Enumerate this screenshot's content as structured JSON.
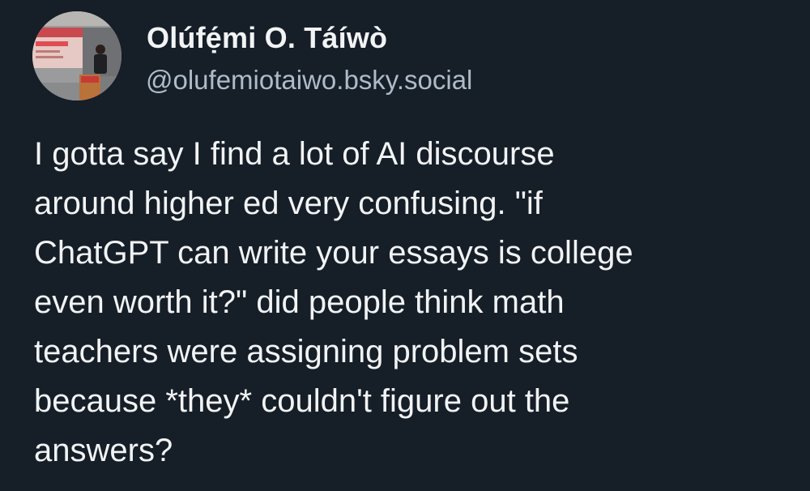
{
  "author": {
    "display_name": "Olúfẹ́mi O. Táíwò",
    "handle": "@olufemiotaiwo.bsky.social",
    "avatar_icon": "profile-photo-lecture-icon"
  },
  "post": {
    "text": "I gotta say I find a lot of AI discourse\naround higher ed very confusing. \"if\nChatGPT can write your essays is college\neven worth it?\" did people think math\nteachers were assigning problem sets\nbecause *they* couldn't figure out the\nanswers?"
  },
  "colors": {
    "background": "#161e27",
    "text": "#f1f3f5",
    "handle": "#aebbc9"
  }
}
